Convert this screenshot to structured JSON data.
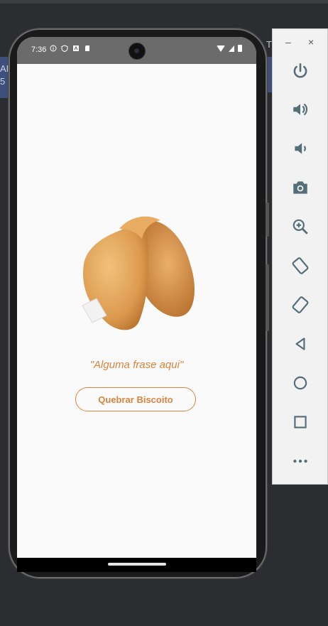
{
  "ide": {
    "behind_text": [
      "AI",
      "5"
    ],
    "top_right_letter": "T"
  },
  "status_bar": {
    "time": "7:36"
  },
  "app": {
    "phrase": "\"Alguma frase aqui\"",
    "button_label": "Quebrar Biscoito"
  },
  "emulator_toolbar": {
    "minimize_label": "–",
    "close_label": "×",
    "buttons": [
      "power-icon",
      "volume-up-icon",
      "volume-down-icon",
      "camera-icon",
      "zoom-icon",
      "rotate-left-icon",
      "rotate-right-icon",
      "back-icon",
      "home-icon",
      "overview-icon",
      "more-icon"
    ]
  },
  "colors": {
    "accent": "#d9843e",
    "status_bar": "#6b6b6b",
    "toolbar_icon": "#546e7a"
  }
}
